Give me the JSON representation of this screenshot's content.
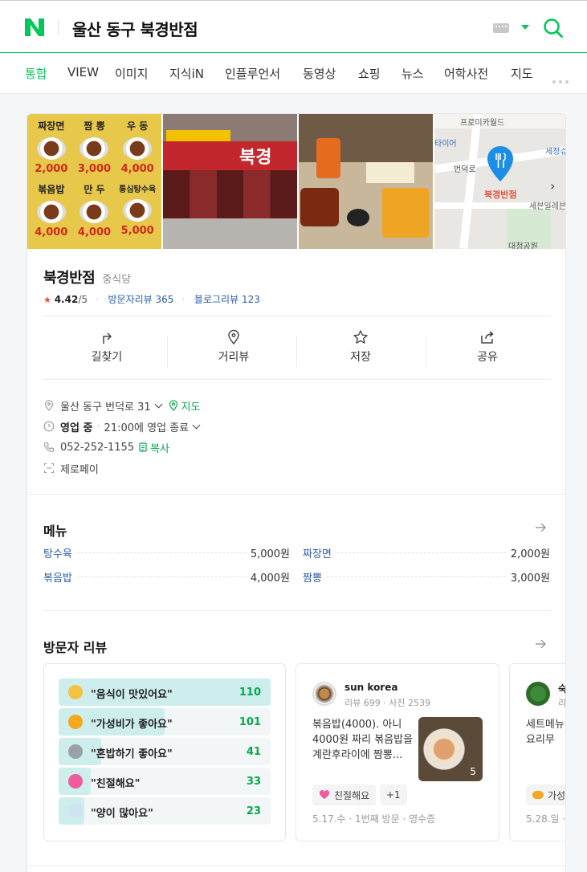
{
  "header": {
    "logo": "N",
    "query": "울산 동구 북경반점"
  },
  "tabs": [
    {
      "label": "통합",
      "active": true
    },
    {
      "label": "VIEW"
    },
    {
      "label": "이미지"
    },
    {
      "label": "지식iN"
    },
    {
      "label": "인플루언서"
    },
    {
      "label": "동영상"
    },
    {
      "label": "쇼핑"
    },
    {
      "label": "뉴스"
    },
    {
      "label": "어학사전"
    },
    {
      "label": "지도"
    }
  ],
  "photos": {
    "menu_board": [
      {
        "name": "짜장면",
        "price": "2,000"
      },
      {
        "name": "짬 뽕",
        "price": "3,000"
      },
      {
        "name": "우 동",
        "price": "4,000"
      },
      {
        "name": "볶음밥",
        "price": "4,000"
      },
      {
        "name": "만 두",
        "price": "4,000"
      },
      {
        "name": "통심탕수육",
        "price": "5,000"
      }
    ],
    "store_sign": "북경",
    "map": {
      "labels": [
        "프로미카월드",
        "타이어",
        "세정슈",
        "번덕로",
        "세븐일레븐",
        "대청공원"
      ],
      "pin_label": "북경반점"
    }
  },
  "place": {
    "name": "북경반점",
    "category": "중식당",
    "rating": "4.42",
    "rating_max": "/5",
    "visitor_review_label": "방문자리뷰",
    "visitor_review_count": "365",
    "blog_review_label": "블로그리뷰",
    "blog_review_count": "123"
  },
  "actions": [
    {
      "label": "길찾기",
      "icon": "directions-icon"
    },
    {
      "label": "거리뷰",
      "icon": "location-pin-icon"
    },
    {
      "label": "저장",
      "icon": "star-icon"
    },
    {
      "label": "공유",
      "icon": "share-icon"
    }
  ],
  "info": {
    "address": "울산 동구 번덕로 31",
    "map_link": "지도",
    "status": "영업 중",
    "hours": "21:00에 영업 종료",
    "phone": "052-252-1155",
    "copy": "복사",
    "payment": "제로페이"
  },
  "menu": {
    "title": "메뉴",
    "items": [
      {
        "name": "탕수육",
        "price": "5,000원"
      },
      {
        "name": "짜장면",
        "price": "2,000원"
      },
      {
        "name": "볶음밥",
        "price": "4,000원"
      },
      {
        "name": "짬뽕",
        "price": "3,000원"
      }
    ]
  },
  "reviews": {
    "title": "방문자 리뷰",
    "keywords": [
      {
        "text": "\"음식이 맛있어요\"",
        "count": "110",
        "ratio": 1.0,
        "emoji_color": "#f5c242"
      },
      {
        "text": "\"가성비가 좋아요\"",
        "count": "101",
        "ratio": 0.5,
        "emoji_color": "#f2a91e"
      },
      {
        "text": "\"혼밥하기 좋아요\"",
        "count": "41",
        "ratio": 0.2,
        "emoji_color": "#9aa0a6"
      },
      {
        "text": "\"친절해요\"",
        "count": "33",
        "ratio": 0.15,
        "emoji_color": "#ef5b9c"
      },
      {
        "text": "\"양이 많아요\"",
        "count": "23",
        "ratio": 0.12,
        "emoji_color": "#cfe3f0"
      }
    ],
    "review_1": {
      "author": "sun korea",
      "meta": "리뷰 699 · 사진 2539",
      "body": "볶음밥(4000). 아니 4000원 짜리 볶음밥을 계란후라이에 짬뽕...",
      "photo_count": "5",
      "tag": "친절해요",
      "tag_extra": "+1",
      "date": "5.17.수 · 1번째 방문 · 영수증"
    },
    "review_2": {
      "author": "숙",
      "meta": "리",
      "body": "세트메뉴 요 요리무",
      "tag": "가성",
      "date": "5.28.일 ·"
    }
  }
}
